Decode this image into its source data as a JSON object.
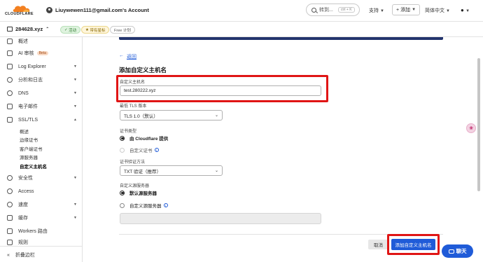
{
  "header": {
    "logo_text": "CLOUDFLARE",
    "account": "Liuywewen111@gmail.com's Account",
    "search_label": "转到...",
    "search_kbd": "ctrl + K",
    "support": "支持",
    "add": "添加",
    "language": "简体中文"
  },
  "zone": {
    "name": "284628.xyz",
    "status_badge": "活动",
    "star_badge": "带有星标",
    "plan_badge": "Free 计划"
  },
  "sidebar": {
    "items": [
      {
        "label": "概述"
      },
      {
        "label": "AI 审核",
        "badge": "Beta"
      },
      {
        "label": "Log Explorer"
      },
      {
        "label": "分析和日志"
      },
      {
        "label": "DNS"
      },
      {
        "label": "电子邮件"
      },
      {
        "label": "SSL/TLS"
      },
      {
        "label": "安全性"
      },
      {
        "label": "Access"
      },
      {
        "label": "速度"
      },
      {
        "label": "缓存"
      },
      {
        "label": "Workers 路由"
      },
      {
        "label": "规则"
      }
    ],
    "ssl_sub": [
      "概述",
      "边缘证书",
      "客户端证书",
      "源服务器",
      "自定义主机名"
    ],
    "collapse_label": "折叠边栏"
  },
  "main": {
    "back_label": "返回",
    "back_arrow": "←",
    "title": "添加自定义主机名",
    "hostname_label": "自定义主机名",
    "hostname_value": "test.280222.xyz",
    "tls_label": "最低 TLS 版本",
    "tls_value": "TLS 1.0（默认）",
    "cert_type_label": "证书类型",
    "cert_opt_cloudflare": "由 Cloudflare 提供",
    "cert_opt_custom": "自定义证书",
    "verify_label": "证书验证方法",
    "verify_value": "TXT 验证（推荐）",
    "origin_label": "自定义源服务器",
    "origin_opt_default": "默认源服务器",
    "origin_opt_custom": "自定义源服务器",
    "cancel_label": "取消",
    "submit_label": "添加自定义主机名"
  },
  "chat": {
    "label": "聊天"
  },
  "colors": {
    "accent": "#1f5bd8",
    "annotation": "#e01515",
    "brand_orange": "#f38020"
  }
}
